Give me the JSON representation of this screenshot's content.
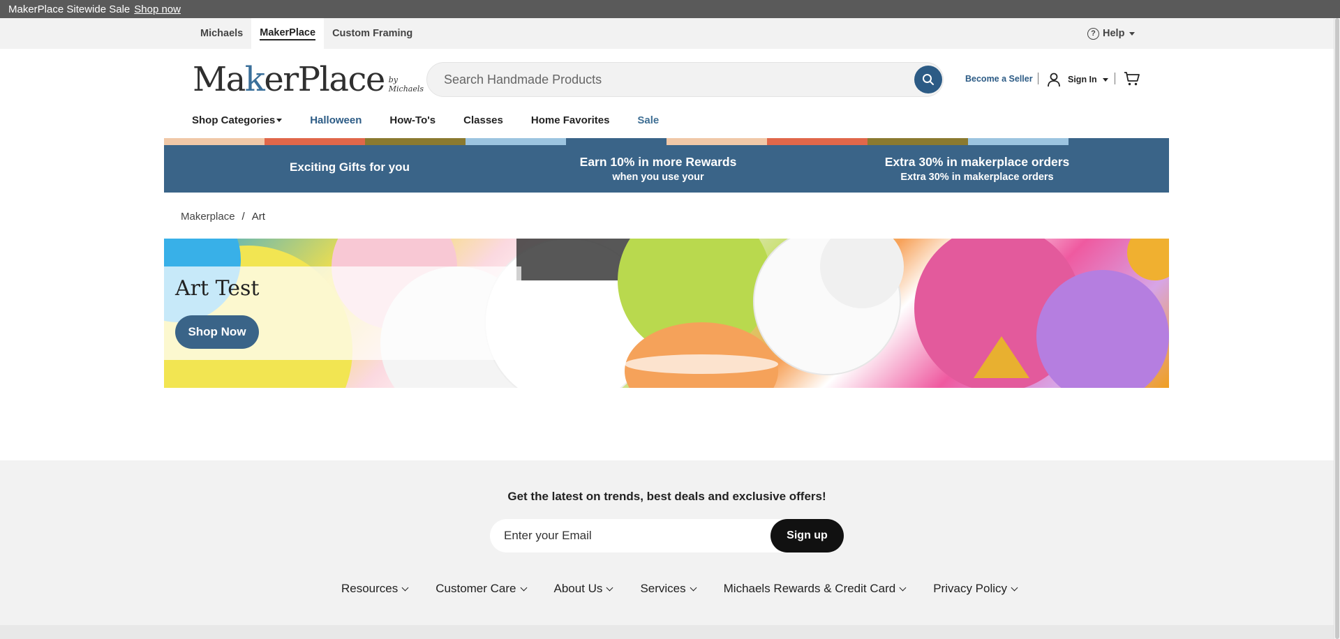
{
  "promo_bar": {
    "text": "MakerPlace Sitewide Sale",
    "link": "Shop now"
  },
  "util_bar": {
    "tabs": [
      "Michaels",
      "MakerPlace",
      "Custom Framing"
    ],
    "help": "Help"
  },
  "header": {
    "logo_word_start": "Ma",
    "logo_word_mid": "k",
    "logo_word_end": "erPlace",
    "logo_by": "by Michaels",
    "search_placeholder": "Search Handmade Products",
    "become_seller": "Become a Seller",
    "sign_in": "Sign In"
  },
  "nav": {
    "items": [
      "Shop Categories",
      "Halloween",
      "How-To's",
      "Classes",
      "Home Favorites",
      "Sale"
    ]
  },
  "promo_banner": {
    "stripe_colors": [
      "#f0c8a8",
      "#e0674a",
      "#8a7a30",
      "#9cc4e0",
      "#3a6488",
      "#f0c8a8",
      "#e0674a",
      "#8a7a30",
      "#9cc4e0",
      "#3a6488"
    ],
    "cells": [
      {
        "title": "Exciting Gifts for you",
        "subtitle": ""
      },
      {
        "title": "Earn 10% in more Rewards",
        "subtitle": "when you use your"
      },
      {
        "title": "Extra 30% in makerplace orders",
        "subtitle": "Extra 30% in makerplace orders"
      }
    ]
  },
  "breadcrumb": {
    "items": [
      "Makerplace",
      "Art"
    ],
    "separator": "/"
  },
  "hero": {
    "title": "Art Test",
    "button": "Shop Now"
  },
  "footer": {
    "newsletter_title": "Get the latest on trends, best deals and exclusive offers!",
    "email_placeholder": "Enter your Email",
    "signup": "Sign up",
    "links": [
      "Resources",
      "Customer Care",
      "About Us",
      "Services",
      "Michaels Rewards & Credit Card",
      "Privacy Policy"
    ]
  },
  "colors": {
    "brand_blue": "#3a6488",
    "accent_blue": "#2c5b85",
    "promo_bar": "#5a5a5a"
  }
}
